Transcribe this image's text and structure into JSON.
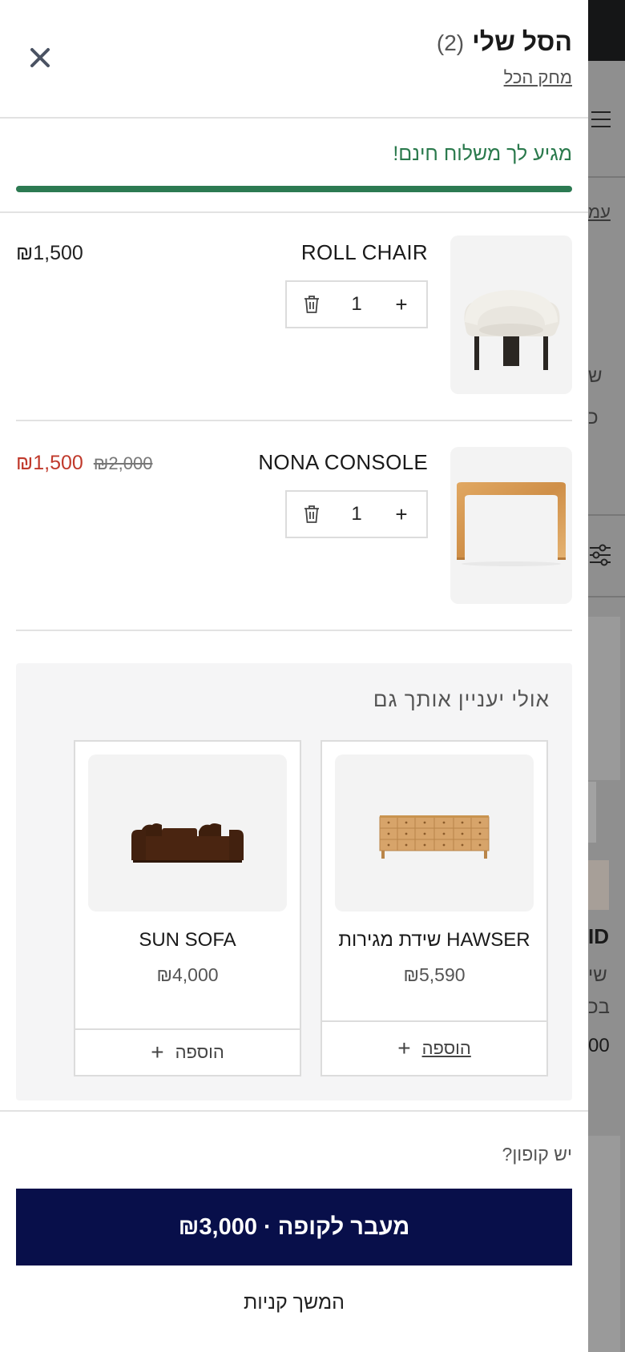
{
  "cart": {
    "title": "הסל שלי",
    "count": "(2)",
    "clear_all": "מחק הכל"
  },
  "shipping": {
    "message": "מגיע לך משלוח חינם!",
    "progress_fraction": 1.0,
    "color": "#2c7a52"
  },
  "items": [
    {
      "name": "ROLL CHAIR",
      "quantity": "1",
      "price": "₪1,500",
      "old_price": ""
    },
    {
      "name": "NONA CONSOLE",
      "quantity": "1",
      "price": "₪1,500",
      "old_price": "₪2,000"
    }
  ],
  "upsell": {
    "title": "אולי יעניין אותך גם",
    "products": [
      {
        "name": "HAWSER שידת מגירות",
        "price": "₪5,590",
        "add_label": "הוספה"
      },
      {
        "name": "SUN SOFA",
        "price": "₪4,000",
        "add_label": "הוספה"
      }
    ]
  },
  "footer": {
    "coupon": "יש קופון?",
    "checkout": "מעבר לקופה · ₪3,000",
    "continue": "המשך קניות"
  },
  "background_page": {
    "texts": [
      "עמ",
      "ש",
      "כ",
      "ID",
      "שי",
      "בכ",
      "00"
    ]
  },
  "icons": {
    "close": "close-icon",
    "trash": "trash-icon",
    "plus": "plus-icon",
    "menu": "hamburger-icon",
    "filter": "filter-icon"
  },
  "colors": {
    "checkout_bg": "#080f4a",
    "sale_price": "#c0392b",
    "shipping_text": "#2b7a4d"
  }
}
